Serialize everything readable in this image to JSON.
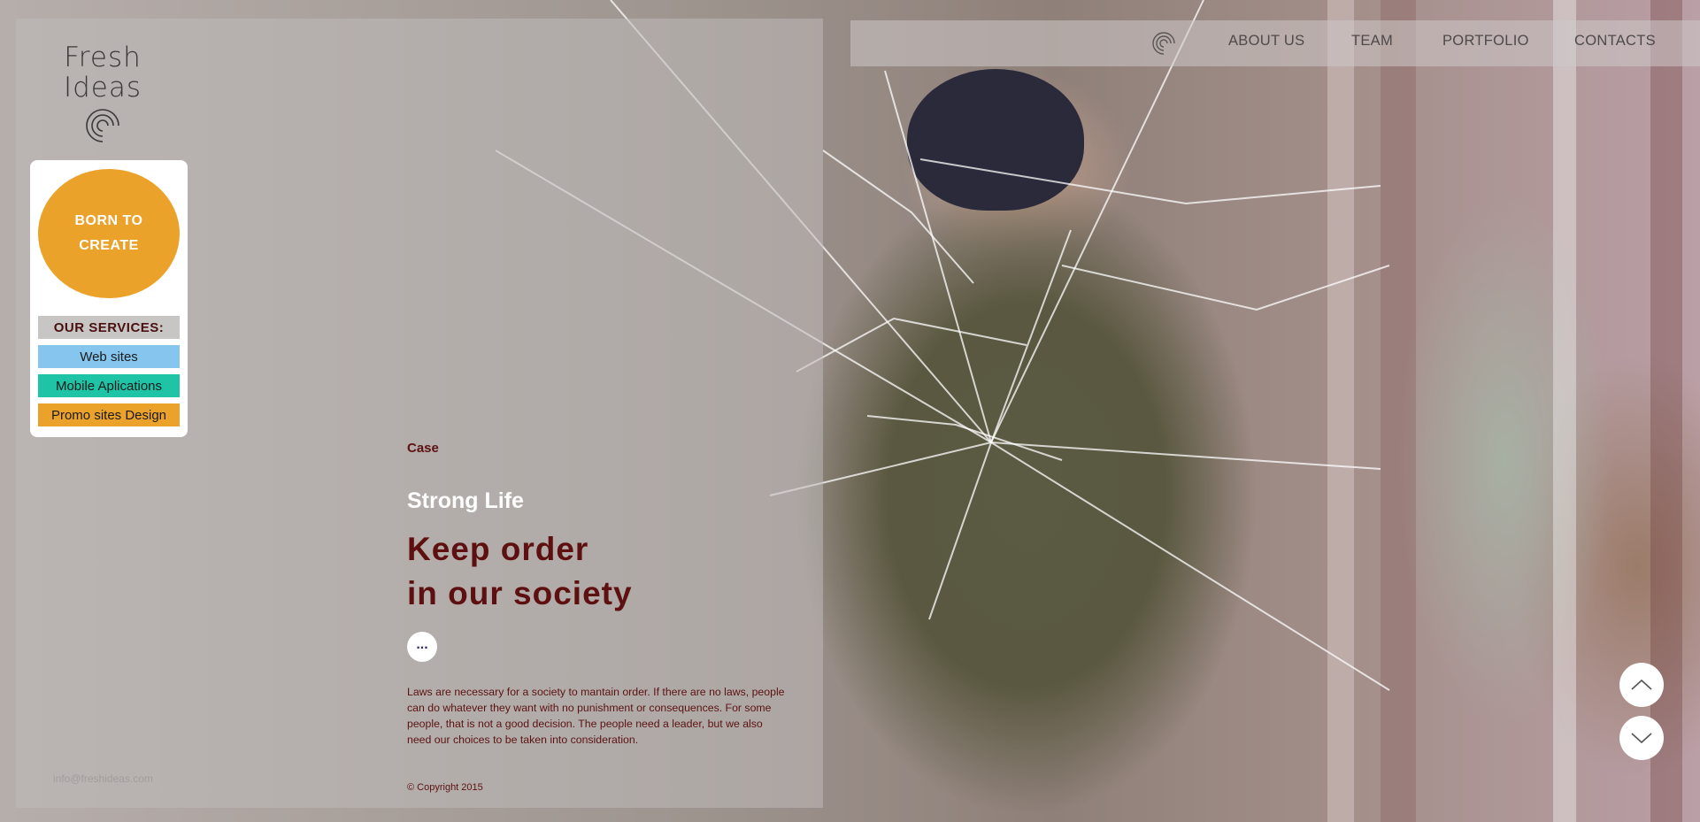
{
  "brand": {
    "logo_text_line1": "Fresh",
    "logo_text_line2": "Ideas",
    "logo_icon": "spiral-logo-icon"
  },
  "nav": {
    "icon": "spiral-icon",
    "items": [
      {
        "label": "ABOUT US"
      },
      {
        "label": "TEAM"
      },
      {
        "label": "PORTFOLIO"
      },
      {
        "label": "CONTACTS"
      }
    ]
  },
  "promo": {
    "circle_line1": "BORN TO",
    "circle_line2": "CREATE",
    "services_heading": "OUR SERVICES:",
    "services": [
      {
        "label": "Web sites",
        "color": "#86c6ee"
      },
      {
        "label": "Mobile Aplications",
        "color": "#1fc4a6"
      },
      {
        "label": "Promo sites Design",
        "color": "#eba22b"
      }
    ]
  },
  "contact": {
    "line1": "",
    "line2": "",
    "email": "info@freshideas.com"
  },
  "hero": {
    "label": "Case",
    "subtitle": "Strong Life",
    "headline_line1": "Keep order",
    "headline_line2": "in our society",
    "more_label": "...",
    "description": "Laws are necessary for a society to mantain order. If there are no laws, people can do whatever they want with no punishment or consequences. For some people, that is not a good decision. The people need a leader, but we also need our choices to be taken into consideration.",
    "copyright": "© Copyright 2015"
  },
  "scroll": {
    "up_icon": "chevron-up-icon",
    "down_icon": "chevron-down-icon"
  },
  "colors": {
    "accent_orange": "#eba22b",
    "dark_red": "#5e0f0f",
    "teal": "#1fc4a6",
    "sky_blue": "#86c6ee"
  }
}
